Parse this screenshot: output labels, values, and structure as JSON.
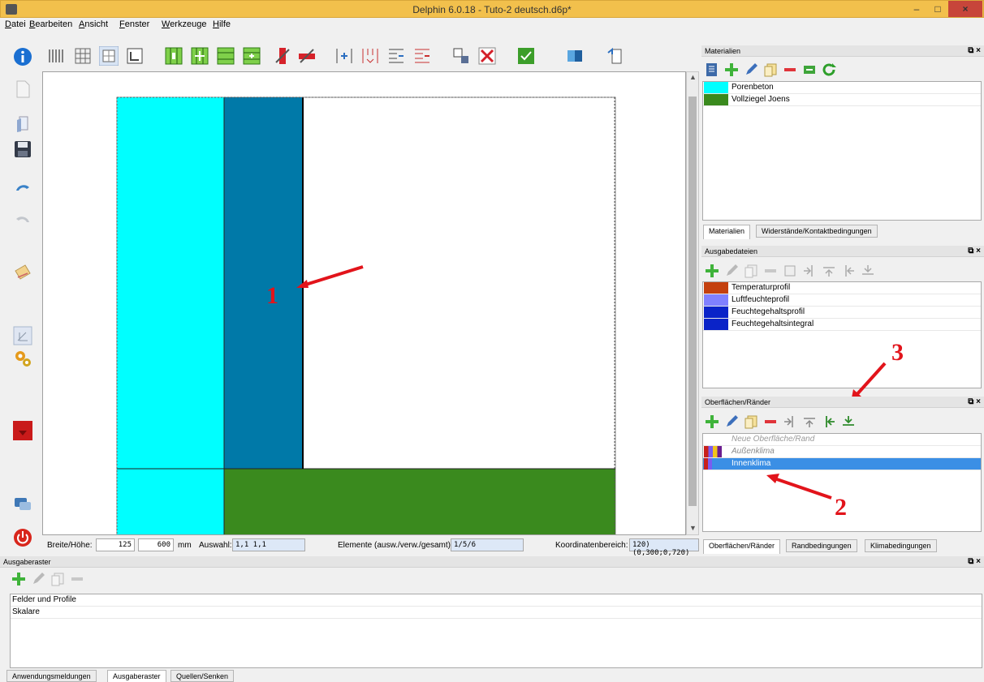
{
  "window": {
    "title": "Delphin 6.0.18 - Tuto-2 deutsch.d6p*",
    "min_label": "–",
    "max_label": "□",
    "close_label": "×"
  },
  "menu": {
    "items": [
      "Datei",
      "Bearbeiten",
      "Ansicht",
      "Fenster",
      "Werkzeuge",
      "Hilfe"
    ]
  },
  "statusbar": {
    "size_label": "Breite/Höhe:",
    "width_value": "125",
    "height_value": "600",
    "unit": "mm",
    "selection_label": "Auswahl:",
    "selection_value": "1,1 1,1",
    "elements_label": "Elemente (ausw./verw./gesamt):",
    "elements_value": "1/5/6",
    "coords_label": "Koordinatenbereich:",
    "coords_value": "120) (0,300;0,720)"
  },
  "materials_panel": {
    "title": "Materialien",
    "items": [
      {
        "label": "Porenbeton",
        "color": "#00ffff"
      },
      {
        "label": "Vollziegel Joens",
        "color": "#3a8a1e"
      }
    ],
    "tabs": [
      "Materialien",
      "Widerstände/Kontaktbedingungen"
    ]
  },
  "outputs_panel": {
    "title": "Ausgabedateien",
    "items": [
      {
        "label": "Temperaturprofil",
        "color": "#c4400e"
      },
      {
        "label": "Luftfeuchteprofil",
        "color": "#8080ff"
      },
      {
        "label": "Feuchtegehaltsprofil",
        "color": "#0a23c8"
      },
      {
        "label": "Feuchtegehaltsintegral",
        "color": "#0a23c8"
      }
    ]
  },
  "surfaces_panel": {
    "title": "Oberflächen/Ränder",
    "items": [
      {
        "label": "Neue Oberfläche/Rand",
        "state": "placeholder"
      },
      {
        "label": "Außenklima",
        "state": "italic"
      },
      {
        "label": "Innenklima",
        "state": "selected"
      }
    ],
    "tabs": [
      "Oberflächen/Ränder",
      "Randbedingungen",
      "Klimabedingungen"
    ]
  },
  "output_grid_panel": {
    "title": "Ausgaberaster",
    "rows": [
      "Felder und Profile",
      "Skalare"
    ],
    "tabs": [
      "Anwendungsmeldungen",
      "Ausgaberaster",
      "Quellen/Senken"
    ]
  },
  "annotations": [
    "1",
    "2",
    "3"
  ],
  "colors": {
    "porenbeton": "#00ffff",
    "porenbeton_selected": "#0079a8",
    "ziegel": "#3a8a1e",
    "title_bar": "#f2c04c",
    "annotation": "#e2141b",
    "selection": "#3b8fe5"
  }
}
